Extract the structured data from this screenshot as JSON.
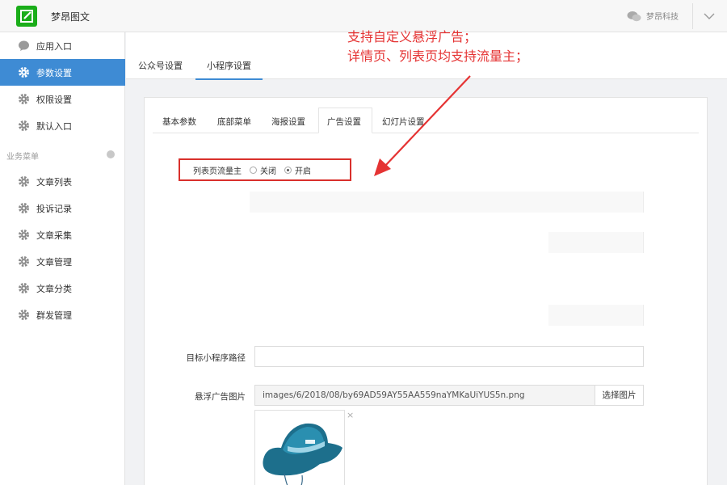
{
  "header": {
    "app_name": "梦昂图文",
    "account_name": "梦昂科技"
  },
  "sidebar": {
    "items": [
      {
        "label": "应用入口",
        "icon": "chat-bubble-icon"
      },
      {
        "label": "参数设置",
        "icon": "gear-icon",
        "active": true
      },
      {
        "label": "权限设置",
        "icon": "gear-icon"
      },
      {
        "label": "默认入口",
        "icon": "gear-icon"
      }
    ],
    "section_label": "业务菜单",
    "business_items": [
      {
        "label": "文章列表",
        "icon": "gear-icon"
      },
      {
        "label": "投诉记录",
        "icon": "gear-icon"
      },
      {
        "label": "文章采集",
        "icon": "gear-icon"
      },
      {
        "label": "文章管理",
        "icon": "gear-icon"
      },
      {
        "label": "文章分类",
        "icon": "gear-icon"
      },
      {
        "label": "群发管理",
        "icon": "gear-icon"
      }
    ]
  },
  "main_tabs": [
    "公众号设置",
    "小程序设置"
  ],
  "panel_tabs": [
    "基本参数",
    "底部菜单",
    "海报设置",
    "广告设置",
    "幻灯片设置"
  ],
  "form": {
    "list_ad_label": "列表页流量主",
    "option_off": "关闭",
    "option_on": "开启",
    "selected": "开启",
    "target_path_label": "目标小程序路径",
    "target_path_value": "",
    "float_ad_label": "悬浮广告图片",
    "float_ad_value": "images/6/2018/08/by69AD59AY55AA559naYMKaUiYUS5n.png",
    "select_image_button": "选择图片",
    "remove_symbol": "×"
  },
  "annotation": {
    "line1": "支持自定义悬浮广告；",
    "line2": "详情页、列表页均支持流量主；"
  },
  "colors": {
    "accent": "#3e8bd4",
    "annotation": "#e53333",
    "logo": "#1aad19"
  }
}
